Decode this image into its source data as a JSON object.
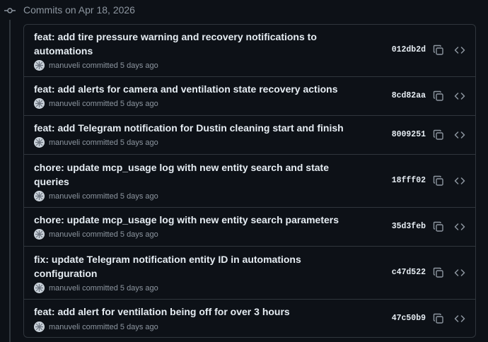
{
  "group": {
    "title": "Commits on Apr 18, 2026",
    "icon": "git-commit-icon"
  },
  "commits": [
    {
      "title": "feat: add tire pressure warning and recovery notifications to automations",
      "author": "manuveli",
      "committed_text": "committed",
      "time": "5 days ago",
      "sha": "012db2d"
    },
    {
      "title": "feat: add alerts for camera and ventilation state recovery actions",
      "author": "manuveli",
      "committed_text": "committed",
      "time": "5 days ago",
      "sha": "8cd82aa"
    },
    {
      "title": "feat: add Telegram notification for Dustin cleaning start and finish",
      "author": "manuveli",
      "committed_text": "committed",
      "time": "5 days ago",
      "sha": "8009251"
    },
    {
      "title": "chore: update mcp_usage log with new entity search and state queries",
      "author": "manuveli",
      "committed_text": "committed",
      "time": "5 days ago",
      "sha": "18fff02"
    },
    {
      "title": "chore: update mcp_usage log with new entity search parameters",
      "author": "manuveli",
      "committed_text": "committed",
      "time": "5 days ago",
      "sha": "35d3feb"
    },
    {
      "title": "fix: update Telegram notification entity ID in automations configuration",
      "author": "manuveli",
      "committed_text": "committed",
      "time": "5 days ago",
      "sha": "c47d522"
    },
    {
      "title": "feat: add alert for ventilation being off for over 3 hours",
      "author": "manuveli",
      "committed_text": "committed",
      "time": "5 days ago",
      "sha": "47c50b9"
    }
  ],
  "icons": {
    "copy": "copy-icon",
    "browse": "code-icon",
    "avatar": "avatar-icon"
  },
  "colors": {
    "background": "#0d1117",
    "border": "#30363d",
    "text_primary": "#e6edf3",
    "text_muted": "#8d96a0"
  }
}
